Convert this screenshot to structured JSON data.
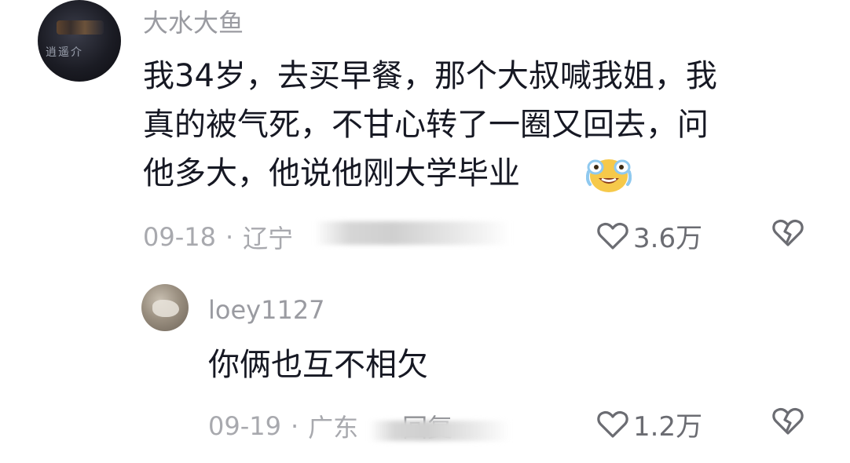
{
  "comments": [
    {
      "username": "大水大鱼",
      "avatar_text": "逍遥介",
      "lines": [
        "我34岁，去买早餐，那个大叔喊我姐，我",
        "真的被气死，不甘心转了一圈又回去，问",
        "他多大，他说他刚大学毕业"
      ],
      "emoji": "laugh-cry-emoji",
      "date": "09-18",
      "separator": "·",
      "location": "辽宁",
      "likes": "3.6万"
    },
    {
      "username": "loey1127",
      "text": "你俩也互不相欠",
      "date": "09-19",
      "separator": "·",
      "location": "广东",
      "reply_label": "回复",
      "likes": "1.2万"
    }
  ],
  "icons": {
    "like": "heart-outline-icon",
    "dislike": "broken-heart-icon"
  },
  "colors": {
    "text": "#161823",
    "secondary": "#a8a9ae",
    "username": "#9a9ba1"
  }
}
